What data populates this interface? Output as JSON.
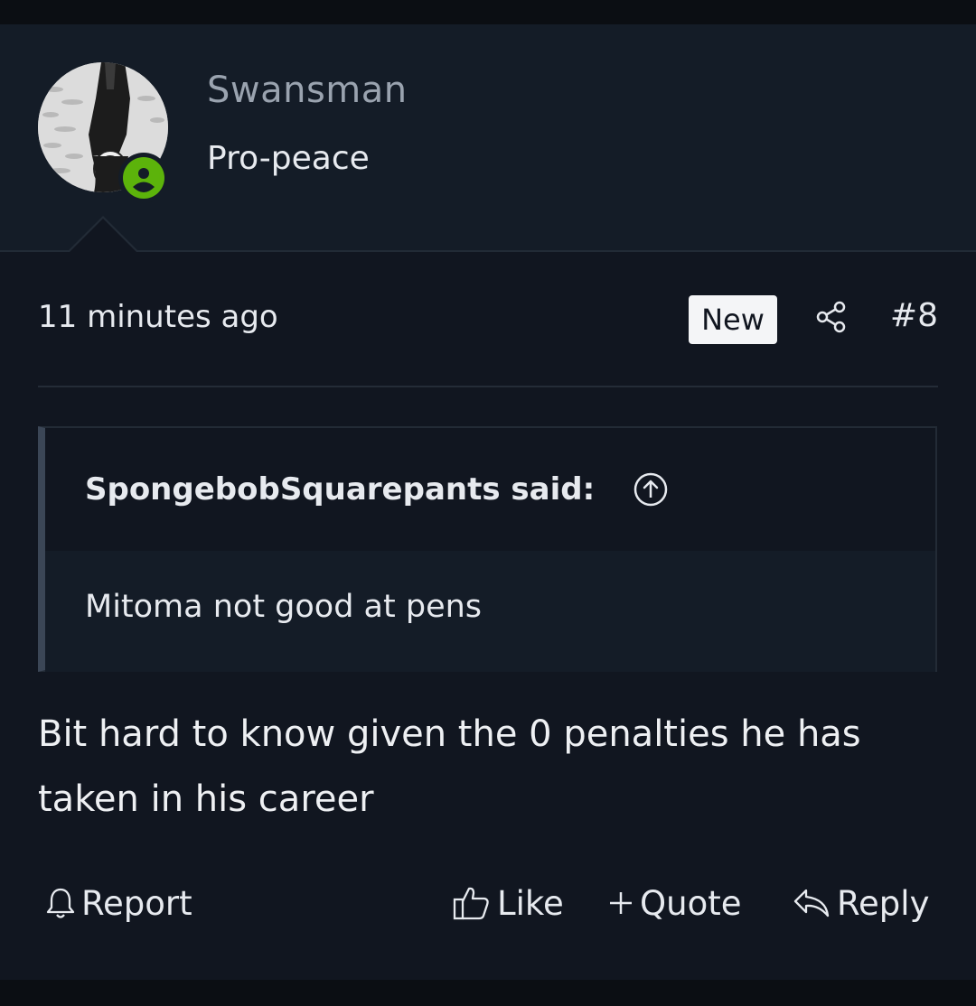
{
  "user": {
    "name": "Swansman",
    "title": "Pro-peace",
    "status": "online"
  },
  "post": {
    "timestamp": "11 minutes ago",
    "badge": "New",
    "number": "#8",
    "quote": {
      "author": "SpongebobSquarepants said:",
      "text": "Mitoma not good at pens"
    },
    "message": "Bit hard to know given the 0 penalties he has taken in his career"
  },
  "actions": {
    "report": "Report",
    "like": "Like",
    "quote": "Quote",
    "reply": "Reply"
  },
  "colors": {
    "online": "#5cb30b",
    "header_bg": "#141c27",
    "post_bg": "#111620",
    "username": "#9aa3af"
  },
  "icons": [
    "user-online-icon",
    "share-icon",
    "arrow-up-circle-icon",
    "bell-icon",
    "thumbs-up-icon",
    "plus-icon",
    "reply-icon"
  ]
}
